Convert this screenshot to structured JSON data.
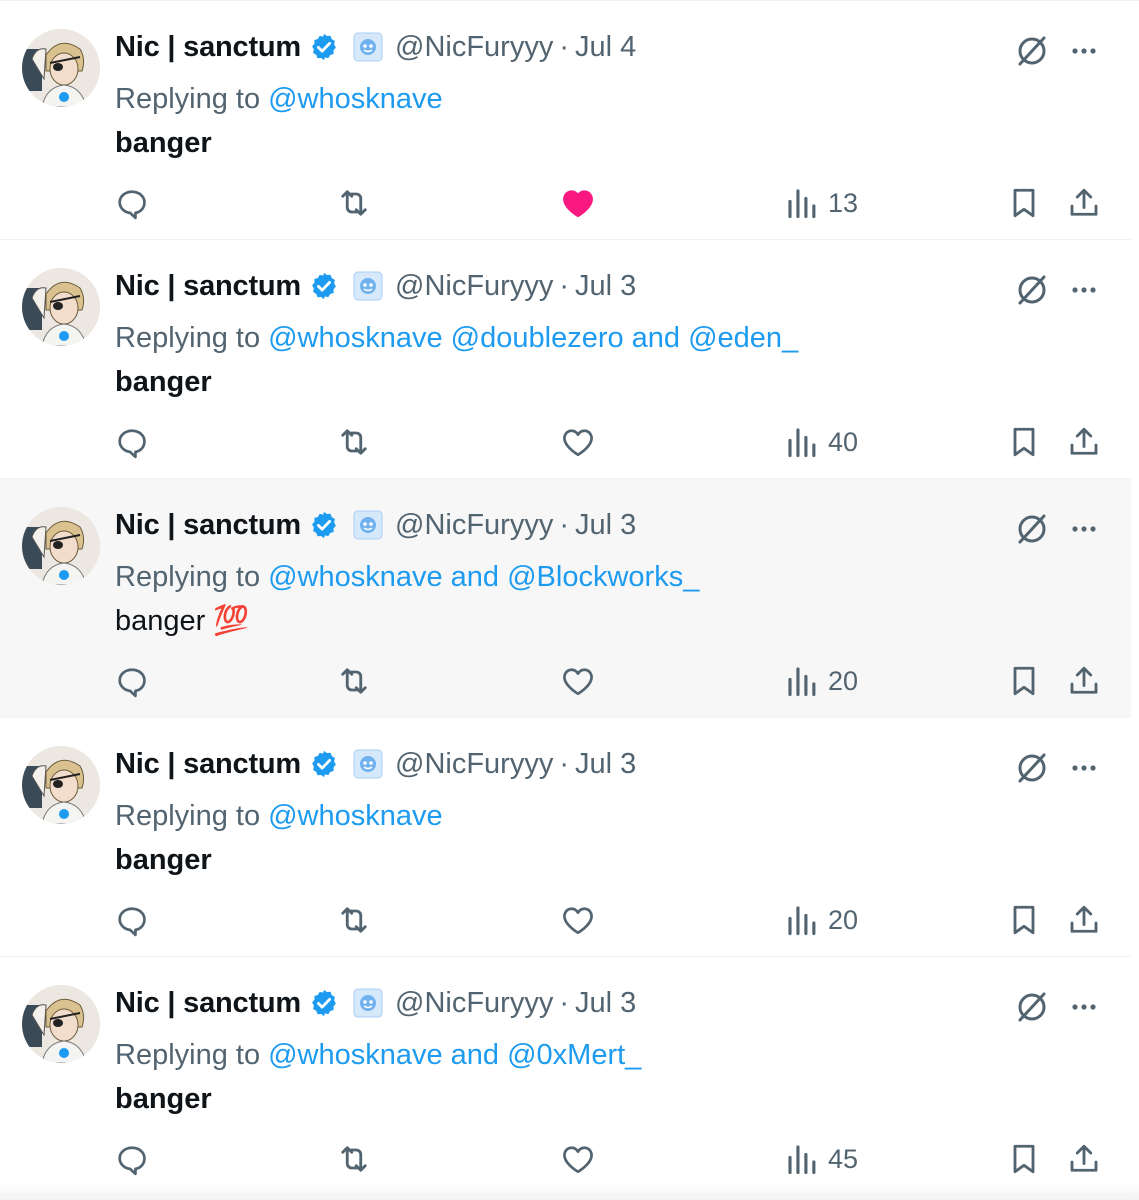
{
  "colors": {
    "link": "#1d9bf0",
    "muted": "#536471",
    "text": "#0f1419",
    "like_active": "#f91880",
    "verified": "#1d9bf0",
    "hover_bg": "#f7f7f7"
  },
  "tweets": [
    {
      "display_name": "Nic | sanctum",
      "handle": "@NicFuryyy",
      "separator": "·",
      "date": "Jul 4",
      "reply_prefix": "Replying to",
      "reply_mentions": "@whosknave",
      "text": "banger",
      "text_bold": true,
      "views": "13",
      "show_views": false,
      "liked": true,
      "hovered": false,
      "icons": [
        "reply-icon",
        "repost-icon",
        "like-icon-filled",
        "views-icon",
        "bookmark-icon",
        "share-icon"
      ]
    },
    {
      "display_name": "Nic | sanctum",
      "handle": "@NicFuryyy",
      "separator": "·",
      "date": "Jul 3",
      "reply_prefix": "Replying to",
      "reply_mentions": "@whosknave @doublezero and @eden_",
      "text": "banger",
      "text_bold": true,
      "views": "40",
      "liked": false,
      "hovered": false
    },
    {
      "display_name": "Nic | sanctum",
      "handle": "@NicFuryyy",
      "separator": "·",
      "date": "Jul 3",
      "reply_prefix": "Replying to",
      "reply_mentions": "@whosknave and @Blockworks_",
      "text": "banger 💯",
      "text_bold": false,
      "views": "20",
      "liked": false,
      "hovered": true
    },
    {
      "display_name": "Nic | sanctum",
      "handle": "@NicFuryyy",
      "separator": "·",
      "date": "Jul 3",
      "reply_prefix": "Replying to",
      "reply_mentions": "@whosknave",
      "text": "banger",
      "text_bold": true,
      "views": "20",
      "liked": false,
      "hovered": false
    },
    {
      "display_name": "Nic | sanctum",
      "handle": "@NicFuryyy",
      "separator": "·",
      "date": "Jul 3",
      "reply_prefix": "Replying to",
      "reply_mentions": "@whosknave and @0xMert_",
      "text": "banger",
      "text_bold": true,
      "views": "45",
      "liked": false,
      "hovered": false
    }
  ]
}
